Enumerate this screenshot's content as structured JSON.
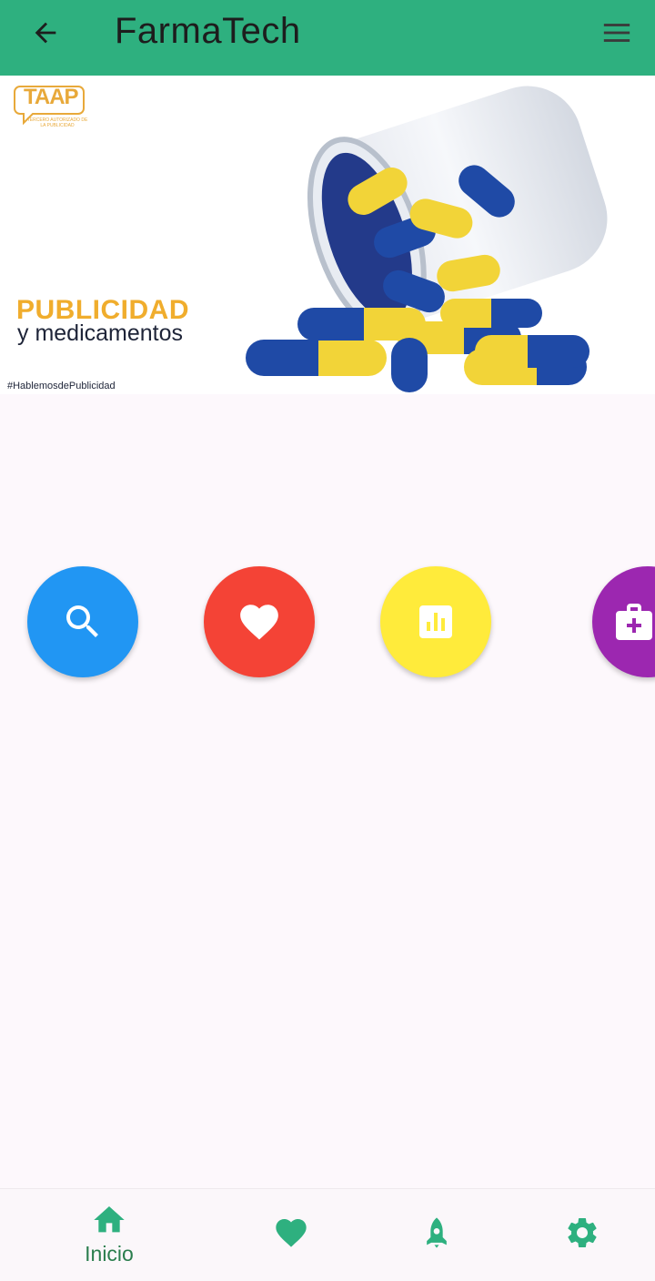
{
  "appbar": {
    "title": "FarmaTech",
    "back_icon": "arrow-back-icon",
    "menu_icon": "hamburger-menu-icon",
    "background": "#2eb07f"
  },
  "banner": {
    "logo_text": "TAAP",
    "logo_subtitle": "TERCERO AUTORIZADO DE LA PUBLICIDAD",
    "heading": "PUBLICIDAD",
    "subheading": "y medicamentos",
    "hashtag": "#HablemosdePublicidad"
  },
  "actions": [
    {
      "icon": "search-icon",
      "color": "#2196f3",
      "label": ""
    },
    {
      "icon": "heart-icon",
      "color": "#f44336",
      "label": ""
    },
    {
      "icon": "bar-chart-icon",
      "color": "#ffeb3b",
      "label": ""
    },
    {
      "icon": "medical-kit-icon",
      "color": "#9c27b0",
      "label": ""
    }
  ],
  "bottom_nav": {
    "items": [
      {
        "icon": "home-icon",
        "label": "Inicio",
        "active": true
      },
      {
        "icon": "heart-icon",
        "label": ""
      },
      {
        "icon": "rocket-icon",
        "label": ""
      },
      {
        "icon": "gear-icon",
        "label": ""
      }
    ],
    "accent": "#2eb07f"
  }
}
